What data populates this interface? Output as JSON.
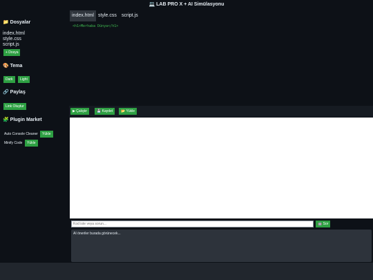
{
  "app": {
    "title": "💻 LAB PRO X + AI Simülasyonu"
  },
  "sidebar": {
    "files_title": "📁 Dosyalar",
    "files": [
      "index.html",
      "style.css",
      "script.js"
    ],
    "add_file_label": "+ Dosya",
    "theme_title": "🎨 Tema",
    "theme_dark": "Dark",
    "theme_light": "Light",
    "share_title": "🔗 Paylaş",
    "share_button": "Link Oluştur",
    "plugin_title": "🧩 Plugin Market",
    "plugins": [
      {
        "name": "Auto Console Cleaner",
        "button": "Yükle"
      },
      {
        "name": "Minify Code",
        "button": "Yükle"
      }
    ]
  },
  "tabs": [
    {
      "label": "index.html",
      "active": true
    },
    {
      "label": "style.css",
      "active": false
    },
    {
      "label": "script.js",
      "active": false
    }
  ],
  "editor": {
    "code": "<h1>Merhaba Dünya</h1>"
  },
  "actions": {
    "run": "▶ Çalıştır",
    "save": "💾 Kaydet",
    "load": "📂 Yükle"
  },
  "ask": {
    "placeholder": "Kod iste veya sorun...",
    "button": "🤖 Sor"
  },
  "ai_panel": {
    "text": "AI öneriler burada görünecek..."
  }
}
